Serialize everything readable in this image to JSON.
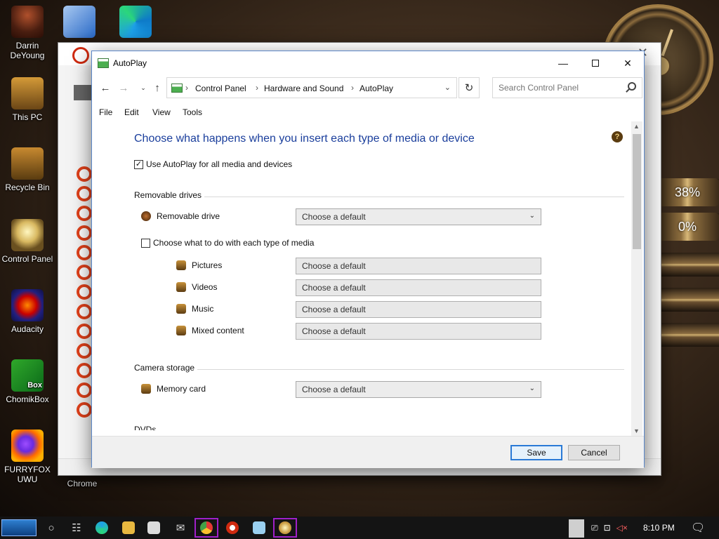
{
  "desktop": {
    "icons": [
      {
        "label": "Darrin DeYoung"
      },
      {
        "label": "This PC"
      },
      {
        "label": "Recycle Bin"
      },
      {
        "label": "Control Panel"
      },
      {
        "label": "Audacity"
      },
      {
        "label": "ChomikBox"
      },
      {
        "label": "FURRYFOX UWU"
      },
      {
        "label": "Chrome"
      }
    ],
    "meters": {
      "top": "38%",
      "bottom": "0%"
    },
    "chomik_badge": "Box"
  },
  "window": {
    "title": "AutoPlay",
    "controls": {
      "minimize": "—",
      "close": "✕"
    }
  },
  "nav": {
    "back": "←",
    "forward": "→",
    "recent": "⌄",
    "up": "↑",
    "breadcrumb": [
      "Control Panel",
      "Hardware and Sound",
      "AutoPlay"
    ],
    "refresh": "↻",
    "search_placeholder": "Search Control Panel"
  },
  "menu": [
    "File",
    "Edit",
    "View",
    "Tools"
  ],
  "content": {
    "heading": "Choose what happens when you insert each type of media or device",
    "help": "?",
    "use_autoplay": {
      "label": "Use AutoPlay for all media and devices",
      "checked": "✓"
    },
    "removable_drives": {
      "section": "Removable drives",
      "drive_label": "Removable drive",
      "drive_value": "Choose a default",
      "each_type": {
        "label": "Choose what to do with each type of media",
        "checked": ""
      },
      "types": [
        {
          "label": "Pictures",
          "value": "Choose a default"
        },
        {
          "label": "Videos",
          "value": "Choose a default"
        },
        {
          "label": "Music",
          "value": "Choose a default"
        },
        {
          "label": "Mixed content",
          "value": "Choose a default"
        }
      ]
    },
    "camera_storage": {
      "section": "Camera storage",
      "label": "Memory card",
      "value": "Choose a default"
    },
    "dvds": {
      "section": "DVDs"
    }
  },
  "footer": {
    "save": "Save",
    "cancel": "Cancel"
  },
  "taskbar": {
    "time": "8:10 PM"
  }
}
